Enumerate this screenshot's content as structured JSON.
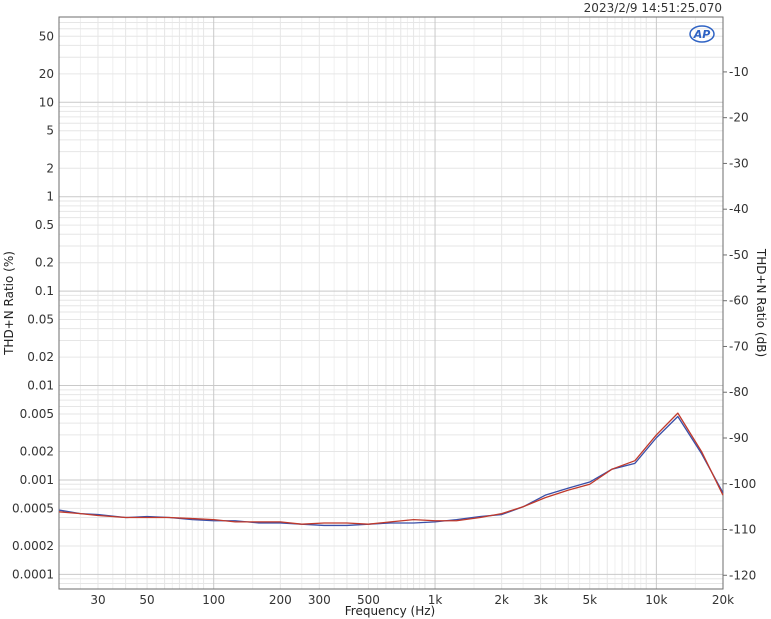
{
  "header": {
    "timestamp": "2023/2/9 14:51:25.070"
  },
  "logo": {
    "icon": "ap-logo-icon",
    "text": "AP",
    "color": "#2f63c4"
  },
  "chart_data": {
    "type": "line",
    "xlabel": "Frequency (Hz)",
    "ylabel_left": "THD+N Ratio (%)",
    "ylabel_right": "THD+N Ratio (dB)",
    "x_scale": "log",
    "y_scale": "log",
    "xlim": [
      20,
      20000
    ],
    "ylim": [
      7e-05,
      80
    ],
    "ylim_db": [
      -123,
      2
    ],
    "grid": true,
    "x_ticks": [
      {
        "v": 30,
        "label": "30"
      },
      {
        "v": 50,
        "label": "50"
      },
      {
        "v": 100,
        "label": "100"
      },
      {
        "v": 200,
        "label": "200"
      },
      {
        "v": 300,
        "label": "300"
      },
      {
        "v": 500,
        "label": "500"
      },
      {
        "v": 1000,
        "label": "1k"
      },
      {
        "v": 2000,
        "label": "2k"
      },
      {
        "v": 3000,
        "label": "3k"
      },
      {
        "v": 5000,
        "label": "5k"
      },
      {
        "v": 10000,
        "label": "10k"
      },
      {
        "v": 20000,
        "label": "20k"
      }
    ],
    "y_ticks_left": [
      {
        "v": 50,
        "label": "50"
      },
      {
        "v": 20,
        "label": "20"
      },
      {
        "v": 10,
        "label": "10"
      },
      {
        "v": 5,
        "label": "5"
      },
      {
        "v": 2,
        "label": "2"
      },
      {
        "v": 1,
        "label": "1"
      },
      {
        "v": 0.5,
        "label": "0.5"
      },
      {
        "v": 0.2,
        "label": "0.2"
      },
      {
        "v": 0.1,
        "label": "0.1"
      },
      {
        "v": 0.05,
        "label": "0.05"
      },
      {
        "v": 0.02,
        "label": "0.02"
      },
      {
        "v": 0.01,
        "label": "0.01"
      },
      {
        "v": 0.005,
        "label": "0.005"
      },
      {
        "v": 0.002,
        "label": "0.002"
      },
      {
        "v": 0.001,
        "label": "0.001"
      },
      {
        "v": 0.0005,
        "label": "0.0005"
      },
      {
        "v": 0.0002,
        "label": "0.0002"
      },
      {
        "v": 0.0001,
        "label": "0.0001"
      }
    ],
    "y_ticks_right": [
      {
        "v": -10,
        "label": "-10"
      },
      {
        "v": -20,
        "label": "-20"
      },
      {
        "v": -30,
        "label": "-30"
      },
      {
        "v": -40,
        "label": "-40"
      },
      {
        "v": -50,
        "label": "-50"
      },
      {
        "v": -60,
        "label": "-60"
      },
      {
        "v": -70,
        "label": "-70"
      },
      {
        "v": -80,
        "label": "-80"
      },
      {
        "v": -90,
        "label": "-90"
      },
      {
        "v": -100,
        "label": "-100"
      },
      {
        "v": -110,
        "label": "-110"
      },
      {
        "v": -120,
        "label": "-120"
      }
    ],
    "series": [
      {
        "color": "#3a4fa8",
        "x": [
          20,
          25,
          30,
          40,
          50,
          63,
          80,
          100,
          125,
          160,
          200,
          250,
          315,
          400,
          500,
          630,
          800,
          1000,
          1250,
          1600,
          2000,
          2500,
          3150,
          4000,
          5000,
          6300,
          8000,
          10000,
          12500,
          16000,
          20000
        ],
        "y": [
          0.00048,
          0.00044,
          0.00043,
          0.0004,
          0.00041,
          0.0004,
          0.00038,
          0.00037,
          0.00037,
          0.00035,
          0.00035,
          0.00034,
          0.00033,
          0.00033,
          0.00034,
          0.00035,
          0.00035,
          0.00036,
          0.00038,
          0.00041,
          0.00043,
          0.00052,
          0.00069,
          0.00082,
          0.00095,
          0.0013,
          0.0015,
          0.0028,
          0.0047,
          0.0019,
          0.00073
        ]
      },
      {
        "color": "#c0392b",
        "x": [
          20,
          25,
          30,
          40,
          50,
          63,
          80,
          100,
          125,
          160,
          200,
          250,
          315,
          400,
          500,
          630,
          800,
          1000,
          1250,
          1600,
          2000,
          2500,
          3150,
          4000,
          5000,
          6300,
          8000,
          10000,
          12500,
          16000,
          20000
        ],
        "y": [
          0.00046,
          0.00044,
          0.00042,
          0.0004,
          0.0004,
          0.0004,
          0.00039,
          0.00038,
          0.00036,
          0.00036,
          0.00036,
          0.00034,
          0.00035,
          0.00035,
          0.00034,
          0.00036,
          0.00038,
          0.00037,
          0.00037,
          0.0004,
          0.00044,
          0.00052,
          0.00065,
          0.00078,
          0.0009,
          0.0013,
          0.0016,
          0.003,
          0.0051,
          0.002,
          0.00069
        ]
      }
    ]
  }
}
